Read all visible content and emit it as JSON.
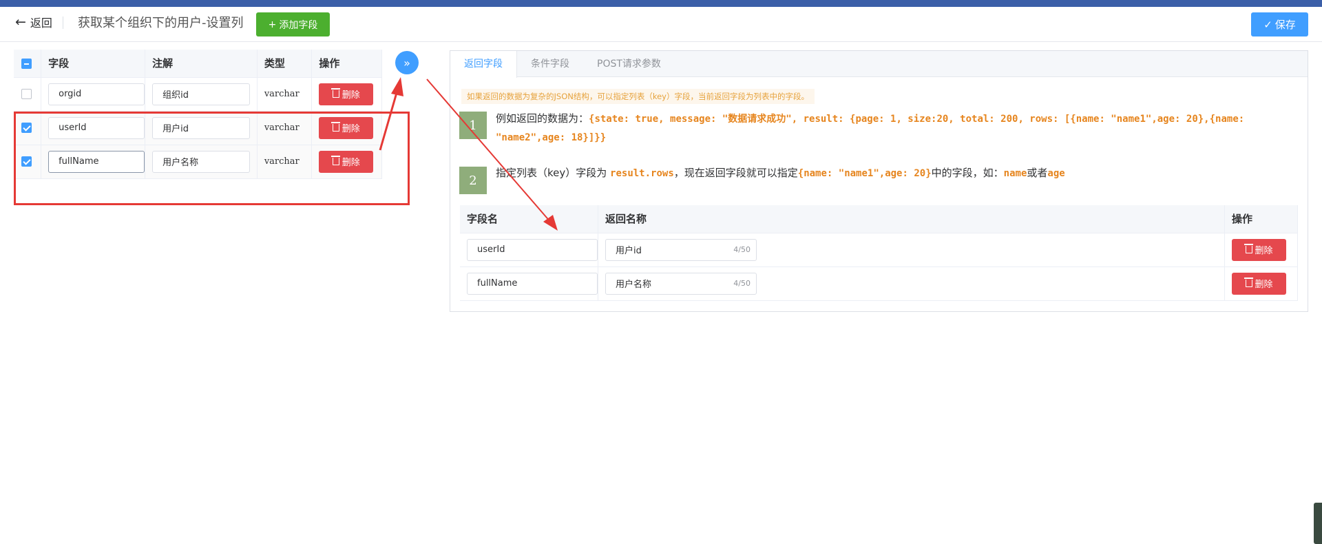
{
  "header": {
    "back_label": "返回",
    "title": "获取某个组织下的用户-设置列",
    "add_field_label": "添加字段",
    "save_label": "保存"
  },
  "left_table": {
    "columns": [
      "字段",
      "注解",
      "类型",
      "操作"
    ],
    "rows": [
      {
        "checked": false,
        "field": "orgid",
        "note": "组织id",
        "type": "varchar",
        "action": "删除"
      },
      {
        "checked": true,
        "field": "userId",
        "note": "用户id",
        "type": "varchar",
        "action": "删除"
      },
      {
        "checked": true,
        "field": "fullName",
        "note": "用户名称",
        "type": "varchar",
        "action": "删除"
      }
    ]
  },
  "transfer_icon": "double-chevron-right-icon",
  "right_panel": {
    "tabs": [
      "返回字段",
      "条件字段",
      "POST请求参数"
    ],
    "active_tab": "返回字段",
    "notice": "如果返回的数据为复杂的JSON结构，可以指定列表（key）字段，当前返回字段为列表中的字段。",
    "step1": {
      "number": "1",
      "prefix": "例如返回的数据为：",
      "code": "{state: true, message: \"数据请求成功\", result: {page: 1, size:20, total: 200, rows: [{name: \"name1\",age: 20},{name: \"name2\",age: 18}]}}"
    },
    "step2": {
      "number": "2",
      "t1": "指定列表（key）字段为 ",
      "c1": "result.rows",
      "t2": "，现在返回字段就可以指定",
      "c2": "{name: \"name1\",age: 20}",
      "t3": "中的字段，如：",
      "c3": "name",
      "t4": "或者",
      "c4": "age"
    },
    "table": {
      "columns": [
        "字段名",
        "返回名称",
        "操作"
      ],
      "rows": [
        {
          "field": "userId",
          "name": "用户id",
          "count": "4/50",
          "action": "删除"
        },
        {
          "field": "fullName",
          "name": "用户名称",
          "count": "4/50",
          "action": "删除"
        }
      ]
    }
  },
  "colors": {
    "primary": "#409eff",
    "success": "#4caf2f",
    "danger": "#e5484d",
    "annotation": "#e53935",
    "code": "#e6851e"
  }
}
